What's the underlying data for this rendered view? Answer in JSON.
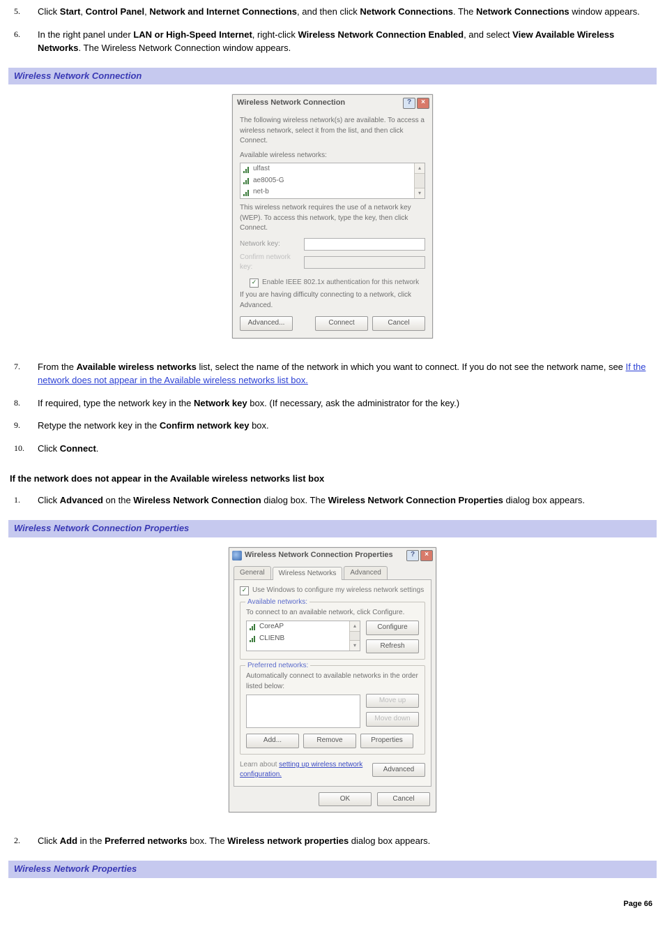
{
  "steps_a": [
    {
      "num": "5.",
      "html": "Click <b>Start</b>, <b>Control Panel</b>, <b>Network and Internet Connections</b>, and then click <b>Network Connections</b>. The <b>Network Connections</b> window appears."
    },
    {
      "num": "6.",
      "html": "In the right panel under <b>LAN or High-Speed Internet</b>, right-click <b>Wireless Network Connection Enabled</b>, and select <b>View Available Wireless Networks</b>. The Wireless Network Connection window appears."
    }
  ],
  "bar1": "Wireless Network Connection",
  "dlg1": {
    "title": "Wireless Network Connection",
    "hint": "The following wireless network(s) are available. To access a wireless network, select it from the list, and then click Connect.",
    "available_label": "Available wireless networks:",
    "networks": [
      "ulfast",
      "ae8005-G",
      "net-b"
    ],
    "wep_hint": "This wireless network requires the use of a network key (WEP). To access this network, type the key, then click Connect.",
    "key_label": "Network key:",
    "confirm_label": "Confirm network key:",
    "chk_label": "Enable IEEE 802.1x authentication for this network",
    "advanced_hint": "If you are having difficulty connecting to a network, click Advanced.",
    "btn_adv": "Advanced...",
    "btn_connect": "Connect",
    "btn_cancel": "Cancel"
  },
  "steps_b": [
    {
      "num": "7.",
      "html": "From the <b>Available wireless networks</b> list, select the name of the network in which you want to connect. If you do not see the network name, see <span class=\"link\" data-name=\"link-not-appear\" data-interactable=\"true\">If the network does not appear in the Available wireless networks list box.</span>"
    },
    {
      "num": "8.",
      "html": "If required, type the network key in the <b>Network key</b> box. (If necessary, ask the administrator for the key.)"
    },
    {
      "num": "9.",
      "html": "Retype the network key in the <b>Confirm network key</b> box."
    },
    {
      "num": "10.",
      "html": "Click <b>Connect</b>."
    }
  ],
  "heading_notappear": "If the network does not appear in the Available wireless networks list box",
  "steps_c": [
    {
      "num": "1.",
      "html": "Click <b>Advanced</b> on the <b>Wireless Network Connection</b> dialog box. The <b>Wireless Network Connection Properties</b> dialog box appears."
    }
  ],
  "bar2": "Wireless Network Connection Properties",
  "dlg2": {
    "title": "Wireless Network Connection Properties",
    "tabs": [
      "General",
      "Wireless Networks",
      "Advanced"
    ],
    "active_tab": 1,
    "chk_configure": "Use Windows to configure my wireless network settings",
    "avail_legend": "Available networks:",
    "avail_hint": "To connect to an available network, click Configure.",
    "avail_items": [
      "CoreAP",
      "CLIENB"
    ],
    "btn_configure": "Configure",
    "btn_refresh": "Refresh",
    "pref_legend": "Preferred networks:",
    "pref_hint": "Automatically connect to available networks in the order listed below:",
    "btn_moveup": "Move up",
    "btn_movedown": "Move down",
    "btn_add": "Add...",
    "btn_remove": "Remove",
    "btn_properties": "Properties",
    "learn_prefix": "Learn about ",
    "learn_link": "setting up wireless network configuration.",
    "btn_advanced": "Advanced",
    "btn_ok": "OK",
    "btn_cancel": "Cancel"
  },
  "steps_d": [
    {
      "num": "2.",
      "html": "Click <b>Add</b> in the <b>Preferred networks</b> box. The <b>Wireless network properties</b> dialog box appears."
    }
  ],
  "bar3": "Wireless Network Properties",
  "page_num": "Page 66"
}
